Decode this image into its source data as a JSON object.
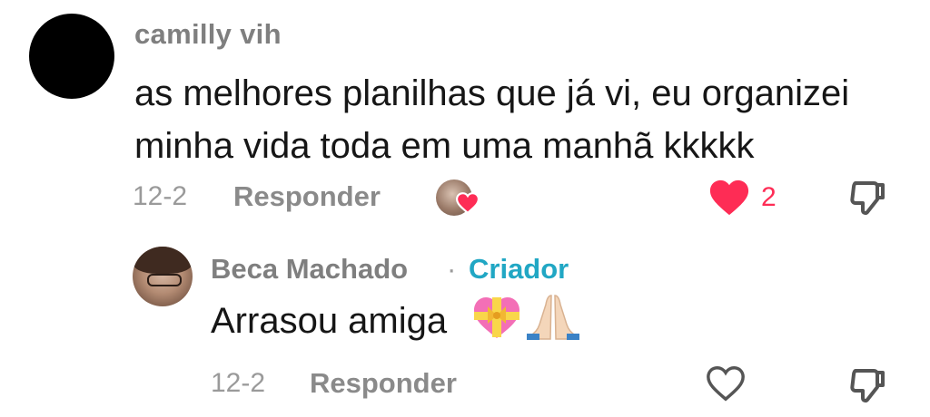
{
  "comment": {
    "username": "camilly vih",
    "text_line1": "as melhores planilhas que já vi, eu organizei",
    "text_line2": "minha vida toda em uma manhã kkkkk",
    "date": "12-2",
    "reply_label": "Responder",
    "like_count": "2",
    "liked": true,
    "creator_liked": true
  },
  "reply": {
    "username": "Beca Machado",
    "separator": "·",
    "badge": "Criador",
    "text": "Arrasou amiga",
    "emojis": [
      "heart-with-ribbon-emoji",
      "folded-hands-emoji"
    ],
    "date": "12-2",
    "reply_label": "Responder",
    "liked": false
  },
  "colors": {
    "like_red": "#fe2c55",
    "creator_blue": "#21a7c4",
    "muted_text": "#8a8a8a"
  }
}
